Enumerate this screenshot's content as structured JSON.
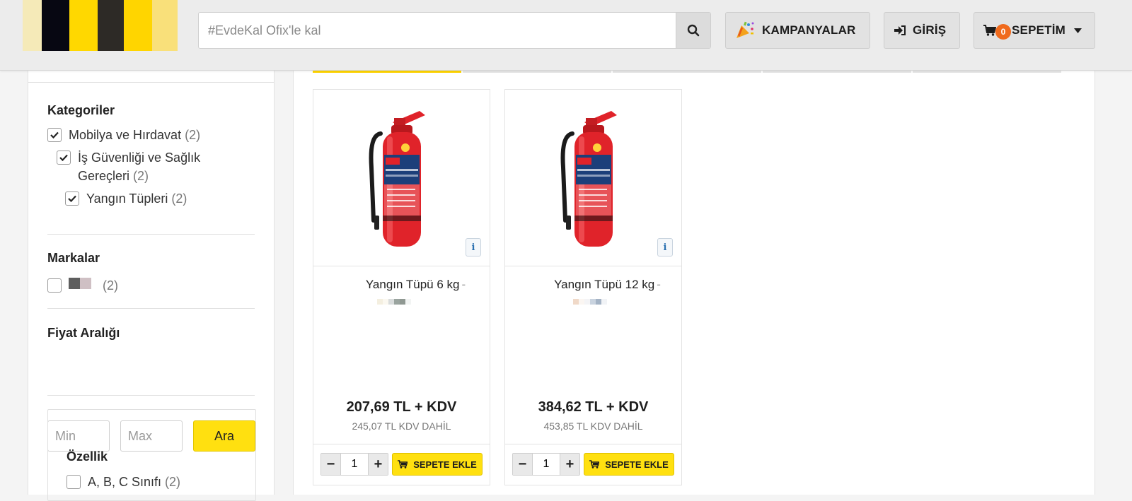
{
  "header": {
    "search_placeholder": "#EvdeKal Ofix'le kal",
    "kampanyalar_label": "KAMPANYALAR",
    "giris_label": "GİRİŞ",
    "sepet_label": "SEPETİM",
    "cart_count": "0",
    "logo_colors": [
      "#ffdd00",
      "#0a0a14",
      "#ffd900",
      "#3a3620",
      "#ffd400",
      "#f8e6a8"
    ]
  },
  "sidebar": {
    "categories_title": "Kategoriler",
    "categories": [
      {
        "label": "Mobilya ve Hırdavat",
        "count": "(2)",
        "checked": true
      },
      {
        "label": "İş Güvenliği ve Sağlık",
        "label_line2": "Gereçleri",
        "count": "(2)",
        "checked": true
      },
      {
        "label": "Yangın Tüpleri",
        "count": "(2)",
        "checked": true
      }
    ],
    "brands_title": "Markalar",
    "brands": [
      {
        "count": "(2)",
        "checked": false
      }
    ],
    "price_title": "Fiyat Aralığı",
    "min_placeholder": "Min",
    "max_placeholder": "Max",
    "ara_label": "Ara",
    "feature_title": "Özellik",
    "features": [
      {
        "label": "A, B, C Sınıfı",
        "count": "(2)",
        "checked": false
      }
    ]
  },
  "products": [
    {
      "name": "Yangın Tüpü 6 kg",
      "dash": "-",
      "price": "207,69 TL + KDV",
      "price_with_tax": "245,07 TL KDV DAHİL",
      "quantity": "1",
      "add_label": "SEPETE EKLE",
      "info_label": "i"
    },
    {
      "name": "Yangın Tüpü 12 kg",
      "dash": "-",
      "price": "384,62 TL + KDV",
      "price_with_tax": "453,85 TL KDV DAHİL",
      "quantity": "1",
      "add_label": "SEPETE EKLE",
      "info_label": "i"
    }
  ],
  "colors": {
    "accent_yellow": "#ffe010",
    "badge_orange": "#f06a1c",
    "extinguisher_red": "#e0232a"
  }
}
